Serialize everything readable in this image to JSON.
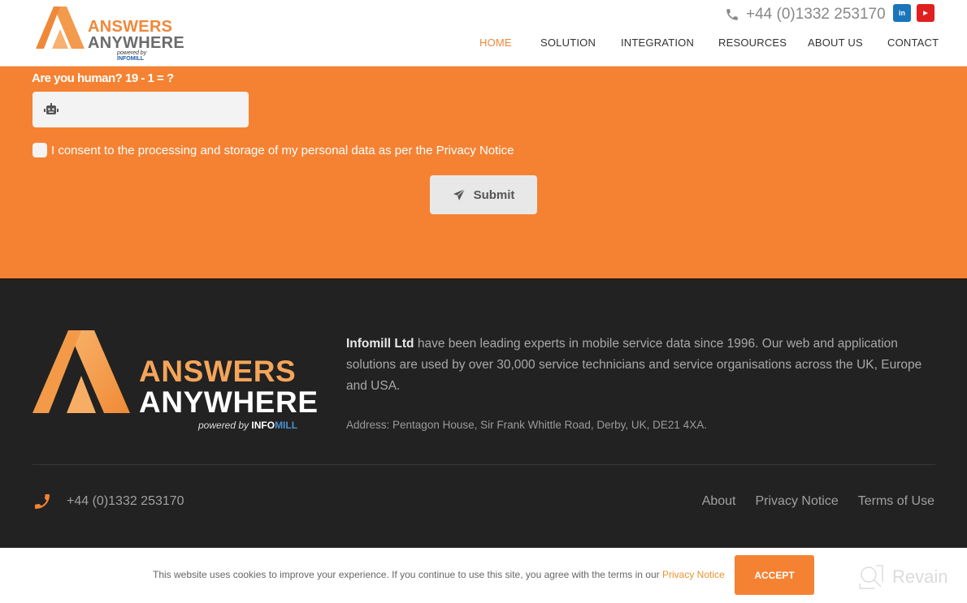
{
  "header": {
    "logo": {
      "line1": "ANSWERS",
      "line2": "ANYWHERE",
      "powered_by": "powered by",
      "brand": "INFOMILL"
    },
    "phone": "+44 (0)1332 253170",
    "social": [
      {
        "name": "linkedin",
        "glyph": "in",
        "color": "#1b75bb"
      },
      {
        "name": "youtube",
        "glyph": "▶",
        "color": "#e02020"
      }
    ],
    "nav": [
      {
        "label": "HOME",
        "active": true
      },
      {
        "label": "SOLUTION",
        "active": false
      },
      {
        "label": "INTEGRATION",
        "active": false
      },
      {
        "label": "RESOURCES",
        "active": false
      },
      {
        "label": "ABOUT US",
        "active": false
      },
      {
        "label": "CONTACT",
        "active": false
      }
    ]
  },
  "form": {
    "captcha_label": "Are you human? 19 - 1 = ?",
    "captcha_value": "",
    "captcha_icon": "robot-icon",
    "consent_text": "I consent to the processing and storage of my personal data as per the Privacy Notice",
    "consent_checked": false,
    "submit_label": "Submit",
    "submit_icon": "paper-plane-icon"
  },
  "footer": {
    "logo": {
      "line1": "ANSWERS",
      "line2": "ANYWHERE",
      "powered_by": "powered by",
      "brand_a": "INFO",
      "brand_b": "MILL"
    },
    "about_company": "Infomill Ltd",
    "about_text": " have been leading experts in mobile service data since 1996. Our web and application solutions are used by over 30,000 service technicians and service organisations across the UK, Europe and USA.",
    "address": "Address: Pentagon House, Sir Frank Whittle Road, Derby, UK, DE21 4XA.",
    "phone": "+44 (0)1332 253170",
    "links": [
      "About",
      "Privacy Notice",
      "Terms of Use"
    ]
  },
  "cookie": {
    "text": "This website uses cookies to improve your experience. If you continue to use this site, you agree with the terms in our ",
    "link": "Privacy Notice",
    "accept_label": "ACCEPT"
  },
  "watermark": {
    "label": "Revain"
  },
  "colors": {
    "brand_orange": "#f58233",
    "footer_bg": "#222222",
    "link_orange": "#e8932f"
  }
}
